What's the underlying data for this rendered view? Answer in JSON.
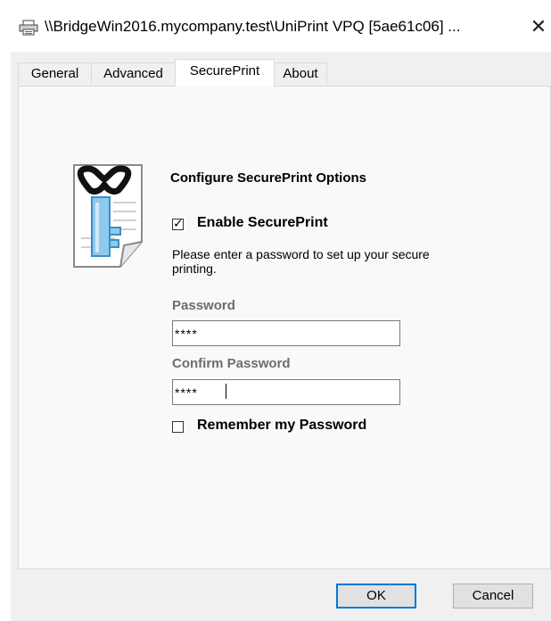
{
  "window": {
    "title": "\\\\BridgeWin2016.mycompany.test\\UniPrint VPQ [5ae61c06] ...",
    "close_glyph": "✕"
  },
  "icons": {
    "printer": "printer-icon",
    "document_key": "document-key-icon",
    "close": "close-icon"
  },
  "tabs": [
    {
      "label": "General",
      "active": false
    },
    {
      "label": "Advanced",
      "active": false
    },
    {
      "label": "SecurePrint",
      "active": true
    },
    {
      "label": "About",
      "active": false
    }
  ],
  "secureprint": {
    "heading": "Configure SecurePrint Options",
    "enable_label": "Enable SecurePrint",
    "enable_checked": true,
    "description": "Please enter a password to set up your secure printing.",
    "password_label": "Password",
    "password_value": "****",
    "confirm_label": "Confirm Password",
    "confirm_value": "****",
    "remember_label": "Remember my Password",
    "remember_checked": false
  },
  "buttons": {
    "ok": "OK",
    "cancel": "Cancel"
  },
  "colors": {
    "accent": "#0078d7",
    "dialog_bg": "#f0f0f0",
    "field_label": "#6d6d6d"
  }
}
